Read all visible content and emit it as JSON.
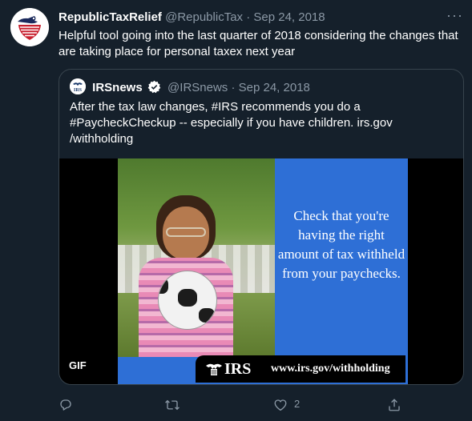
{
  "tweet": {
    "display_name": "RepublicTaxRelief",
    "handle": "@RepublicTax",
    "separator": "·",
    "date": "Sep 24, 2018",
    "more_label": "···",
    "text": "Helpful tool going into the last quarter of 2018 considering the changes that are taking place for personal taxex next year"
  },
  "quoted": {
    "display_name": "IRSnews",
    "handle": "@IRSnews",
    "separator": "·",
    "date": "Sep 24, 2018",
    "text": "After the tax law changes, #IRS recommends you do a #PaycheckCheckup -- especially if you have children. irs.gov /withholding",
    "media": {
      "badge": "GIF",
      "message": "Check that you're having the right amount of tax withheld from your paychecks.",
      "logo_text": "IRS",
      "url": "www.irs.gov/withholding",
      "background_color": "#2e6fd6"
    }
  },
  "actions": {
    "reply_icon": "reply-icon",
    "retweet_icon": "retweet-icon",
    "like_icon": "like-icon",
    "like_count": "2",
    "share_icon": "share-icon"
  },
  "colors": {
    "background": "#15202b",
    "secondary_text": "#8b98a5",
    "border": "#38444d",
    "verified": "#1d9bf0"
  }
}
